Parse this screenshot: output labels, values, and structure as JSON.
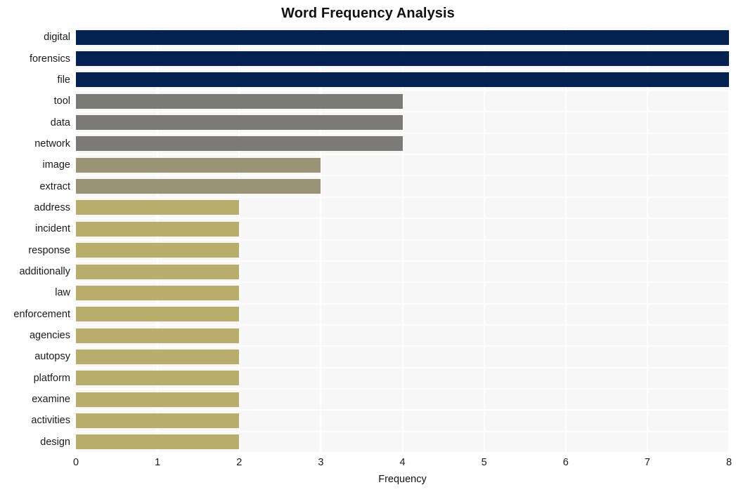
{
  "chart_data": {
    "type": "bar",
    "orientation": "horizontal",
    "title": "Word Frequency Analysis",
    "xlabel": "Frequency",
    "ylabel": "",
    "xlim": [
      0,
      8
    ],
    "xticks": [
      0,
      1,
      2,
      3,
      4,
      5,
      6,
      7,
      8
    ],
    "xtick_labels": [
      "0",
      "1",
      "2",
      "3",
      "4",
      "5",
      "6",
      "7",
      "8"
    ],
    "grid": true,
    "legend": "none",
    "categories": [
      "digital",
      "forensics",
      "file",
      "tool",
      "data",
      "network",
      "image",
      "extract",
      "address",
      "incident",
      "response",
      "additionally",
      "law",
      "enforcement",
      "agencies",
      "autopsy",
      "platform",
      "examine",
      "activities",
      "design"
    ],
    "values": [
      8,
      8,
      8,
      4,
      4,
      4,
      3,
      3,
      2,
      2,
      2,
      2,
      2,
      2,
      2,
      2,
      2,
      2,
      2,
      2
    ],
    "bar_colors": [
      "#032252",
      "#032252",
      "#032252",
      "#7b7a77",
      "#7b7a77",
      "#7b7a77",
      "#9a9376",
      "#9a9376",
      "#b9ad6c",
      "#b9ad6c",
      "#b9ad6c",
      "#b9ad6c",
      "#b9ad6c",
      "#b9ad6c",
      "#b9ad6c",
      "#b9ad6c",
      "#b9ad6c",
      "#b9ad6c",
      "#b9ad6c",
      "#b9ad6c"
    ]
  },
  "style": {
    "plot_background": "#f7f7f7",
    "page_background": "#ffffff",
    "gridline_color": "#ffffff",
    "text_color": "#1a1a1a",
    "title_color": "#111111"
  }
}
